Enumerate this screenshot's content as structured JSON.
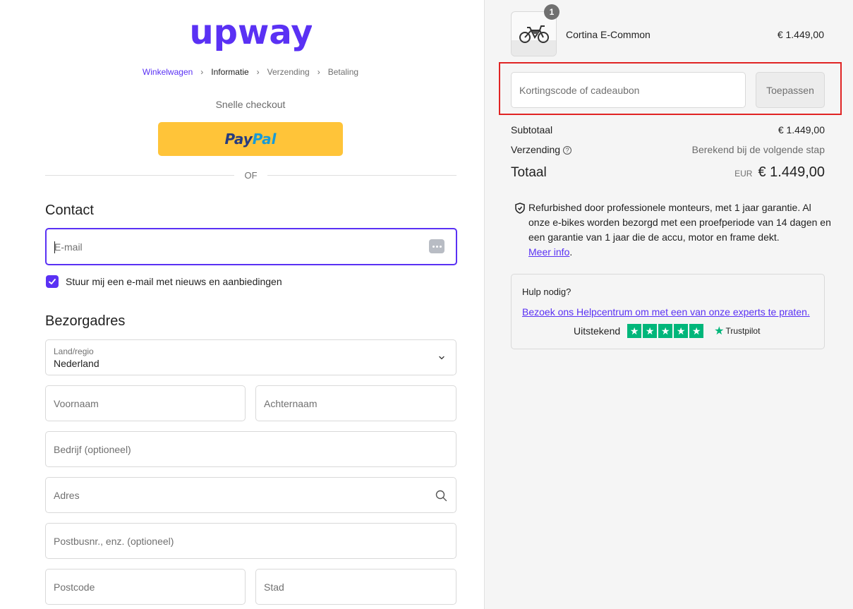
{
  "brand": {
    "logo_text": "upway",
    "accent_color": "#5a31f4"
  },
  "breadcrumb": {
    "items": [
      "Winkelwagen",
      "Informatie",
      "Verzending",
      "Betaling"
    ],
    "current_index": 1
  },
  "express": {
    "title": "Snelle checkout",
    "paypal_part1": "Pay",
    "paypal_part2": "Pal",
    "separator": "OF"
  },
  "contact": {
    "title": "Contact",
    "email_placeholder": "E-mail",
    "newsletter_label": "Stuur mij een e-mail met nieuws en aanbiedingen",
    "newsletter_checked": true
  },
  "shipping_address": {
    "title": "Bezorgadres",
    "country_label": "Land/regio",
    "country_value": "Nederland",
    "first_name_placeholder": "Voornaam",
    "last_name_placeholder": "Achternaam",
    "company_placeholder": "Bedrijf (optioneel)",
    "address_placeholder": "Adres",
    "address2_placeholder": "Postbusnr., enz. (optioneel)",
    "postcode_placeholder": "Postcode",
    "city_placeholder": "Stad"
  },
  "order": {
    "product_name": "Cortina E-Common",
    "product_price": "€ 1.449,00",
    "quantity": "1",
    "discount_placeholder": "Kortingscode of cadeaubon",
    "apply_label": "Toepassen",
    "subtotal_label": "Subtotaal",
    "subtotal_value": "€ 1.449,00",
    "shipping_label": "Verzending",
    "shipping_value": "Berekend bij de volgende stap",
    "total_label": "Totaal",
    "total_currency": "EUR",
    "total_value": "€ 1.449,00"
  },
  "guarantee": {
    "text": "Refurbished door professionele monteurs, met 1 jaar garantie. Al onze e-bikes worden bezorgd met een proefperiode van 14 dagen en een garantie van 1 jaar die de accu, motor en frame dekt.",
    "link_text": "Meer info",
    "after_link": "."
  },
  "help": {
    "title": "Hulp nodig?",
    "link_text": "Bezoek ons Helpcentrum om met een van onze experts te praten.",
    "rating_text": "Uitstekend",
    "stars": 5,
    "trustpilot_label": "Trustpilot"
  }
}
